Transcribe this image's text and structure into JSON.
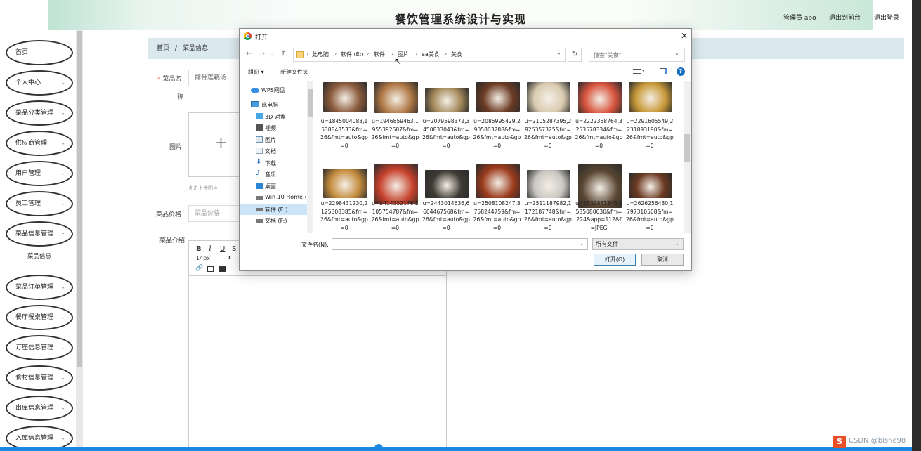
{
  "header": {
    "title": "餐饮管理系统设计与实现",
    "user": "管理员 abo",
    "to_front": "退出到前台",
    "logout": "退出登录"
  },
  "sidebar": {
    "items": [
      {
        "label": "首页"
      },
      {
        "label": "个人中心"
      },
      {
        "label": "菜品分类管理"
      },
      {
        "label": "供应商管理"
      },
      {
        "label": "用户管理"
      },
      {
        "label": "员工管理"
      },
      {
        "label": "菜品信息管理"
      },
      {
        "label": "菜品订单管理"
      },
      {
        "label": "餐厅餐桌管理"
      },
      {
        "label": "订座信息管理"
      },
      {
        "label": "食材信息管理"
      },
      {
        "label": "出库信息管理"
      },
      {
        "label": "入库信息管理"
      }
    ],
    "subitem": "菜品信息",
    "chevron": "⌄"
  },
  "breadcrumb": {
    "home": "首页",
    "sep": "/",
    "current": "菜品信息"
  },
  "form": {
    "name_label_1": "菜品名",
    "name_label_2": "称",
    "name_value": "排骨莲藕汤",
    "image_label": "图片",
    "upload_tip": "点击上传图片",
    "price_label": "菜品价格",
    "price_placeholder": "菜品价格",
    "intro_label": "菜品介绍",
    "font_size": "14px",
    "required_mark": "*"
  },
  "dialog": {
    "title": "打开",
    "path": [
      "此电脑",
      "软件 (E:)",
      "软件",
      "图片",
      "aa美食",
      "美食"
    ],
    "search_placeholder": "搜索\"美食\"",
    "organize": "组织 ▾",
    "new_folder": "新建文件夹",
    "nav_items": [
      {
        "label": "WPS网盘",
        "icon": "cloud-icon"
      },
      {
        "label": "此电脑",
        "icon": "computer-icon"
      },
      {
        "label": "3D 对象",
        "icon": "cube-icon"
      },
      {
        "label": "视频",
        "icon": "video-icon"
      },
      {
        "label": "图片",
        "icon": "picture-icon"
      },
      {
        "label": "文档",
        "icon": "document-icon"
      },
      {
        "label": "下载",
        "icon": "download-icon"
      },
      {
        "label": "音乐",
        "icon": "music-icon"
      },
      {
        "label": "桌面",
        "icon": "desktop-icon"
      },
      {
        "label": "Win 10 Home ›",
        "icon": "drive-icon"
      },
      {
        "label": "软件 (E:)",
        "icon": "drive-icon"
      },
      {
        "label": "文档 (F:)",
        "icon": "drive-icon"
      }
    ],
    "files": [
      {
        "name": "u=1845004083,1538848533&fm=26&fmt=auto&gp=0",
        "color": "#8b5a3c"
      },
      {
        "name": "u=1946859463,1955392587&fm=26&fmt=auto&gp=0",
        "color": "#b07845"
      },
      {
        "name": "u=2079598372,3450833043&fm=26&fmt=auto&gp=0",
        "color": "#a58a5c"
      },
      {
        "name": "u=2085995429,2905803288&fm=26&fmt=auto&gp=0",
        "color": "#6b3b24"
      },
      {
        "name": "u=2105287395,2925357325&fm=26&fmt=auto&gp=0",
        "color": "#d9cbb0"
      },
      {
        "name": "u=2222358764,3253578334&fm=26&fmt=auto&gp=0",
        "color": "#d8543d"
      },
      {
        "name": "u=2291605549,2231893190&fm=26&fmt=auto&gp=0",
        "color": "#c99a3a"
      },
      {
        "name": "u=2298431230,2125308385&fm=26&fmt=auto&gp=0",
        "color": "#c58c3e"
      },
      {
        "name": "u=2414352178,2105754787&fm=26&fmt=auto&gp=0",
        "color": "#c6412c"
      },
      {
        "name": "u=2443014636,6604467568&fm=26&fmt=auto&gp=0",
        "color": "#3e3b34"
      },
      {
        "name": "u=2508108247,3758244759&fm=26&fmt=auto&gp=0",
        "color": "#9b3a1c"
      },
      {
        "name": "u=2511187982,1172187748&fm=26&fmt=auto&gp=0",
        "color": "#c9c6c1"
      },
      {
        "name": "u=2539851845,2585080030&fm=224&app=112&f=JPEG",
        "color": "#5a4632"
      },
      {
        "name": "u=2626256430,1797310508&fm=26&fmt=auto&gp=0",
        "color": "#6b3a22"
      }
    ],
    "filename_label": "文件名(N):",
    "filter_value": "所有文件",
    "open_label": "打开(O)",
    "cancel_label": "取消"
  },
  "watermark": "CSDN @bishe98",
  "colors": {
    "breadcrumb_bg": "#dbe9ef",
    "accent": "#1e88e5"
  }
}
